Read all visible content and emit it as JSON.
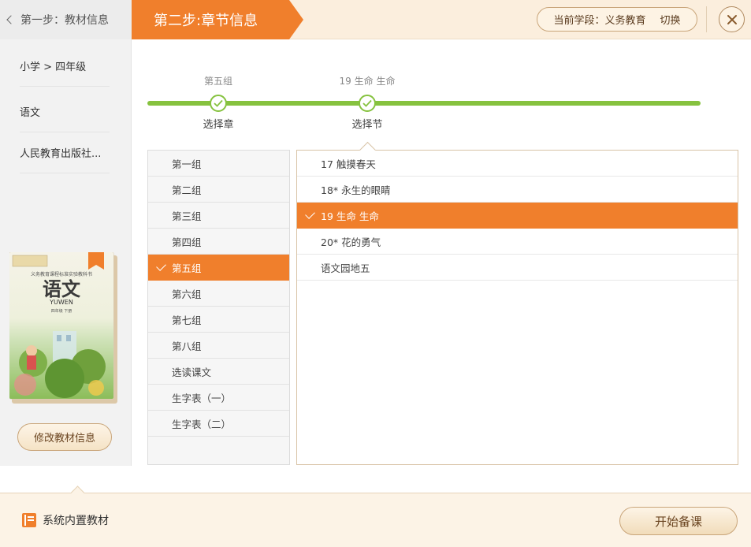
{
  "header": {
    "back_label": "第一步：教材信息",
    "step_title": "第二步:章节信息",
    "stage_label": "当前学段：义务教育",
    "switch_label": "切换"
  },
  "sidebar": {
    "items": [
      "小学 > 四年级",
      "语文",
      "人民教育出版社..."
    ],
    "modify_label": "修改教材信息"
  },
  "book_cover": {
    "series": "义务教育课程标准实验教科书",
    "title": "语文",
    "pinyin": "YUWEN",
    "grade": "四年级  下册"
  },
  "progress": {
    "steps": [
      {
        "top": "第五组",
        "bottom": "选择章"
      },
      {
        "top": "19 生命 生命",
        "bottom": "选择节"
      }
    ]
  },
  "chapters": {
    "items": [
      "第一组",
      "第二组",
      "第三组",
      "第四组",
      "第五组",
      "第六组",
      "第七组",
      "第八组",
      "选读课文",
      "生字表（一）",
      "生字表（二）"
    ],
    "selected_index": 4
  },
  "sections": {
    "items": [
      "17 触摸春天",
      "18* 永生的眼睛",
      "19 生命 生命",
      "20* 花的勇气",
      "语文园地五"
    ],
    "selected_index": 2
  },
  "footer": {
    "builtin_label": "系统内置教材",
    "start_label": "开始备课"
  },
  "colors": {
    "accent": "#f07f2c",
    "progress": "#86c23f",
    "header_bg": "#fbeedd"
  }
}
